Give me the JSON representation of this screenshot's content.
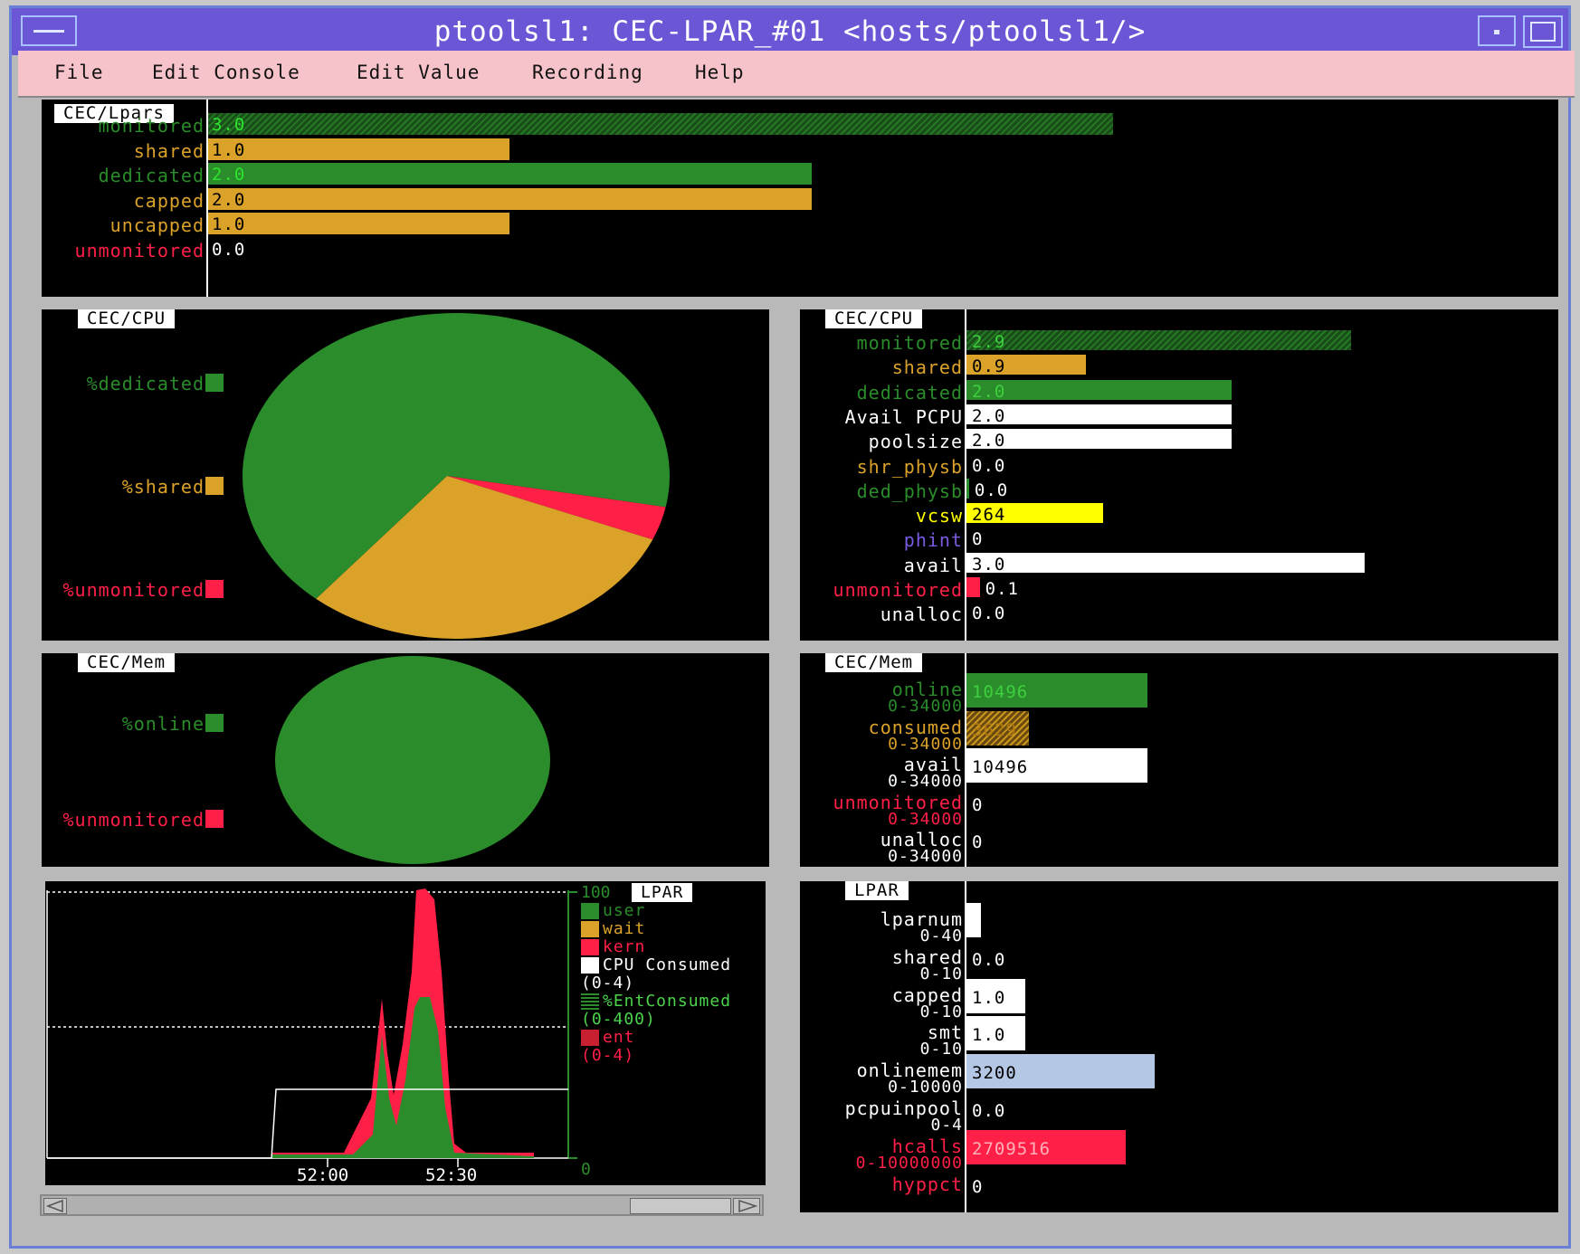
{
  "window": {
    "title": "ptoolsl1: CEC-LPAR_#01 <hosts/ptoolsl1/>"
  },
  "menu": [
    "File",
    "Edit Console",
    "Edit Value",
    "Recording",
    "Help"
  ],
  "colors": {
    "green": "#2a8c2a",
    "orange": "#dba22a",
    "red": "#ff1f47",
    "white": "#ffffff",
    "yellow": "#ffff00",
    "purple": "#7a5adf",
    "lightblue": "#b4c8e6"
  },
  "lpars_panel": {
    "tag": "CEC/Lpars",
    "rows": [
      {
        "label": "monitored",
        "value": "3.0",
        "color": "green",
        "amount": 3.0,
        "hatched": true
      },
      {
        "label": "shared",
        "value": "1.0",
        "color": "orange",
        "amount": 1.0,
        "hatched": false
      },
      {
        "label": "dedicated",
        "value": "2.0",
        "color": "green",
        "amount": 2.0,
        "hatched": false
      },
      {
        "label": "capped",
        "value": "2.0",
        "color": "orange",
        "amount": 2.0,
        "hatched": false
      },
      {
        "label": "uncapped",
        "value": "1.0",
        "color": "orange",
        "amount": 1.0,
        "hatched": false
      },
      {
        "label": "unmonitored",
        "value": "0.0",
        "color": "red",
        "amount": 0.0,
        "hatched": false
      }
    ]
  },
  "cpu_pie": {
    "tag": "CEC/CPU",
    "legend": [
      {
        "label": "%dedicated",
        "color": "green"
      },
      {
        "label": "%shared",
        "color": "orange"
      },
      {
        "label": "%unmonitored",
        "color": "red"
      }
    ],
    "slices": [
      {
        "name": "%dedicated",
        "value": 2.0,
        "color": "green"
      },
      {
        "name": "%shared",
        "value": 0.9,
        "color": "orange"
      },
      {
        "name": "%unmonitored",
        "value": 0.1,
        "color": "red"
      }
    ]
  },
  "cpu_bars": {
    "tag": "CEC/CPU",
    "rows": [
      {
        "label": "monitored",
        "value": "2.9",
        "labelcolor": "green",
        "barcolor": "green",
        "amount": 2.9,
        "hatched": true
      },
      {
        "label": "shared",
        "value": "0.9",
        "labelcolor": "orange",
        "barcolor": "orange",
        "amount": 0.9,
        "hatched": false
      },
      {
        "label": "dedicated",
        "value": "2.0",
        "labelcolor": "green",
        "barcolor": "green",
        "amount": 2.0,
        "hatched": false
      },
      {
        "label": "Avail PCPU",
        "value": "2.0",
        "labelcolor": "white",
        "barcolor": "white",
        "amount": 2.0,
        "hatched": false
      },
      {
        "label": "poolsize",
        "value": "2.0",
        "labelcolor": "white",
        "barcolor": "white",
        "amount": 2.0,
        "hatched": false
      },
      {
        "label": "shr_physb",
        "value": "0.0",
        "labelcolor": "orange",
        "barcolor": "orange",
        "amount": 0.0,
        "hatched": false
      },
      {
        "label": "ded_physb",
        "value": "0.0",
        "labelcolor": "green",
        "barcolor": "green",
        "amount": 0.02,
        "hatched": false
      },
      {
        "label": "vcsw",
        "value": "264",
        "labelcolor": "yellow",
        "barcolor": "yellow",
        "amount": 1.03,
        "hatched": false
      },
      {
        "label": "phint",
        "value": "0",
        "labelcolor": "purple",
        "barcolor": "purple",
        "amount": 0.0,
        "hatched": false
      },
      {
        "label": "avail",
        "value": "3.0",
        "labelcolor": "white",
        "barcolor": "white",
        "amount": 3.0,
        "hatched": false
      },
      {
        "label": "unmonitored",
        "value": "0.1",
        "labelcolor": "red",
        "barcolor": "red",
        "amount": 0.1,
        "hatched": false
      },
      {
        "label": "unalloc",
        "value": "0.0",
        "labelcolor": "white",
        "barcolor": "white",
        "amount": 0.0,
        "hatched": false
      }
    ]
  },
  "mem_pie": {
    "tag": "CEC/Mem",
    "legend": [
      {
        "label": "%online",
        "color": "green"
      },
      {
        "label": "%unmonitored",
        "color": "red"
      }
    ]
  },
  "mem_bars": {
    "tag": "CEC/Mem",
    "rows": [
      {
        "label": "online",
        "range": "0-34000",
        "value": "10496",
        "labelcolor": "green",
        "barcolor": "green",
        "amount": 10496,
        "hatched": false
      },
      {
        "label": "consumed",
        "range": "0-34000",
        "value": "3629",
        "labelcolor": "orange",
        "barcolor": "orange",
        "amount": 3629,
        "hatched": true
      },
      {
        "label": "avail",
        "range": "0-34000",
        "value": "10496",
        "labelcolor": "white",
        "barcolor": "white",
        "amount": 10496,
        "hatched": false
      },
      {
        "label": "unmonitored",
        "range": "0-34000",
        "value": "0",
        "labelcolor": "red",
        "barcolor": "red",
        "amount": 0,
        "hatched": false
      },
      {
        "label": "unalloc",
        "range": "0-34000",
        "value": "0",
        "labelcolor": "white",
        "barcolor": "white",
        "amount": 0,
        "hatched": false
      }
    ]
  },
  "lpar_chart": {
    "tag": "LPAR",
    "ymax_label": "100",
    "ymin_label": "0",
    "x_ticks": [
      "52:00",
      "52:30"
    ],
    "legend": [
      {
        "label": "user",
        "color": "green",
        "hatched": false
      },
      {
        "label": "wait",
        "color": "orange",
        "hatched": false
      },
      {
        "label": "kern",
        "color": "red",
        "hatched": false
      },
      {
        "label": "CPU Consumed",
        "color": "white",
        "hatched": false
      },
      {
        "label": "(0-4)",
        "color": "white",
        "hatched": false
      },
      {
        "label": "%EntConsumed",
        "color": "green",
        "hatched": true
      },
      {
        "label": "(0-400)",
        "color": "green",
        "hatched": false
      },
      {
        "label": "ent",
        "color": "red",
        "hatched": false
      },
      {
        "label": "(0-4)",
        "color": "red",
        "hatched": false
      }
    ]
  },
  "lpar_bars": {
    "tag": "LPAR",
    "rows": [
      {
        "label": "lparnum",
        "range": "0-40",
        "value": "1",
        "labelcolor": "white",
        "barcolor": "white",
        "frac": 0.025
      },
      {
        "label": "shared",
        "range": "0-10",
        "value": "0.0",
        "labelcolor": "white",
        "barcolor": "white",
        "frac": 0.0
      },
      {
        "label": "capped",
        "range": "0-10",
        "value": "1.0",
        "labelcolor": "white",
        "barcolor": "white",
        "frac": 0.1
      },
      {
        "label": "smt",
        "range": "0-10",
        "value": "1.0",
        "labelcolor": "white",
        "barcolor": "white",
        "frac": 0.1
      },
      {
        "label": "onlinemem",
        "range": "0-10000",
        "value": "3200",
        "labelcolor": "white",
        "barcolor": "lightblue",
        "frac": 0.32
      },
      {
        "label": "pcpuinpool",
        "range": "0-4",
        "value": "0.0",
        "labelcolor": "white",
        "barcolor": "white",
        "frac": 0.0
      },
      {
        "label": "hcalls",
        "range": "0-10000000",
        "value": "2709516",
        "labelcolor": "red",
        "barcolor": "red",
        "frac": 0.27
      },
      {
        "label": "hyppct",
        "range": "",
        "value": "0",
        "labelcolor": "red",
        "barcolor": "red",
        "frac": 0.0
      }
    ]
  }
}
